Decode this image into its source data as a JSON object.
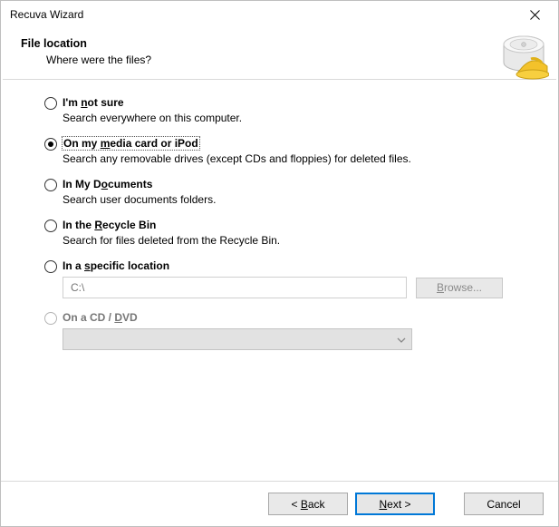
{
  "window": {
    "title": "Recuva Wizard"
  },
  "header": {
    "heading": "File location",
    "subtitle": "Where were the files?"
  },
  "options": [
    {
      "id": "not-sure",
      "label_pre": "I'm ",
      "label_ul": "n",
      "label_post": "ot sure",
      "desc": "Search everywhere on this computer.",
      "selected": false,
      "disabled": false
    },
    {
      "id": "media-card",
      "label_pre": "On my ",
      "label_ul": "m",
      "label_post": "edia card or iPod",
      "desc": "Search any removable drives (except CDs and floppies) for deleted files.",
      "selected": true,
      "disabled": false
    },
    {
      "id": "my-documents",
      "label_pre": "In My D",
      "label_ul": "o",
      "label_post": "cuments",
      "desc": "Search user documents folders.",
      "selected": false,
      "disabled": false
    },
    {
      "id": "recycle-bin",
      "label_pre": "In the ",
      "label_ul": "R",
      "label_post": "ecycle Bin",
      "desc": "Search for files deleted from the Recycle Bin.",
      "selected": false,
      "disabled": false
    },
    {
      "id": "specific-location",
      "label_pre": "In a ",
      "label_ul": "s",
      "label_post": "pecific location",
      "desc": "",
      "selected": false,
      "disabled": false
    },
    {
      "id": "cd-dvd",
      "label_pre": "On a CD / ",
      "label_ul": "D",
      "label_post": "VD",
      "desc": "",
      "selected": false,
      "disabled": true
    }
  ],
  "specific": {
    "path_placeholder": "C:\\",
    "browse_pre": "",
    "browse_ul": "B",
    "browse_post": "rowse..."
  },
  "footer": {
    "back_pre": "< ",
    "back_ul": "B",
    "back_post": "ack",
    "next_pre": "",
    "next_ul": "N",
    "next_post": "ext >",
    "cancel": "Cancel"
  }
}
